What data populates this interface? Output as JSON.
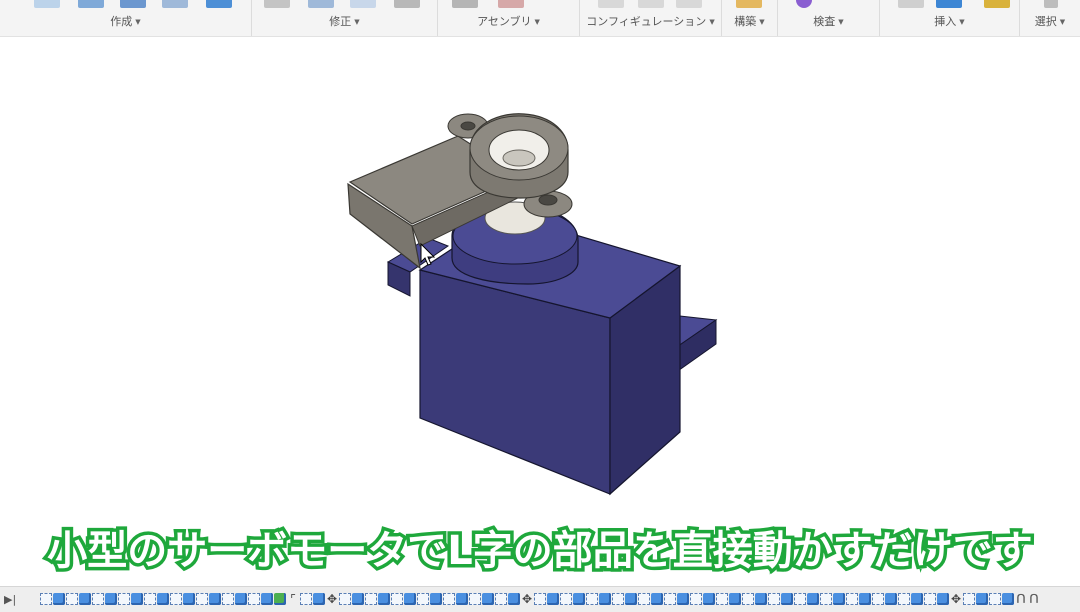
{
  "toolbar": {
    "groups": [
      {
        "id": "create",
        "label": "作成"
      },
      {
        "id": "modify",
        "label": "修正"
      },
      {
        "id": "assemble",
        "label": "アセンブリ"
      },
      {
        "id": "configure",
        "label": "コンフィギュレーション"
      },
      {
        "id": "construct",
        "label": "構築"
      },
      {
        "id": "inspect",
        "label": "検査"
      },
      {
        "id": "insert",
        "label": "挿入"
      },
      {
        "id": "select",
        "label": "選択"
      }
    ]
  },
  "colors": {
    "servo_body": "#3b3a78",
    "servo_top": "#4b4b94",
    "horn": "#8c8880",
    "caption_stroke": "#1fa83c",
    "caption_fill": "#ffffff"
  },
  "caption": {
    "text": "小型のサーボモータでL字の部品を直接動かすだけです"
  },
  "timeline": {
    "play_icon": "play-icon",
    "items": [
      "sketch",
      "body",
      "sketch",
      "body",
      "sketch",
      "body",
      "sketch",
      "body",
      "sketch",
      "body",
      "sketch",
      "body",
      "sketch",
      "body",
      "sketch",
      "body",
      "sketch",
      "body",
      "joint-add",
      "corner",
      "sketch",
      "body",
      "move",
      "sketch",
      "body",
      "sketch",
      "body",
      "sketch",
      "body",
      "sketch",
      "body",
      "sketch",
      "body",
      "sketch",
      "body",
      "sketch",
      "body",
      "move",
      "sketch",
      "body",
      "sketch",
      "body",
      "sketch",
      "body",
      "sketch",
      "body",
      "sketch",
      "body",
      "sketch",
      "body",
      "sketch",
      "body",
      "sketch",
      "body",
      "sketch",
      "body",
      "sketch",
      "body",
      "sketch",
      "body",
      "sketch",
      "body",
      "sketch",
      "body",
      "sketch",
      "body",
      "sketch",
      "body",
      "sketch",
      "body",
      "move",
      "sketch",
      "body",
      "sketch",
      "body",
      "joint",
      "joint"
    ]
  }
}
